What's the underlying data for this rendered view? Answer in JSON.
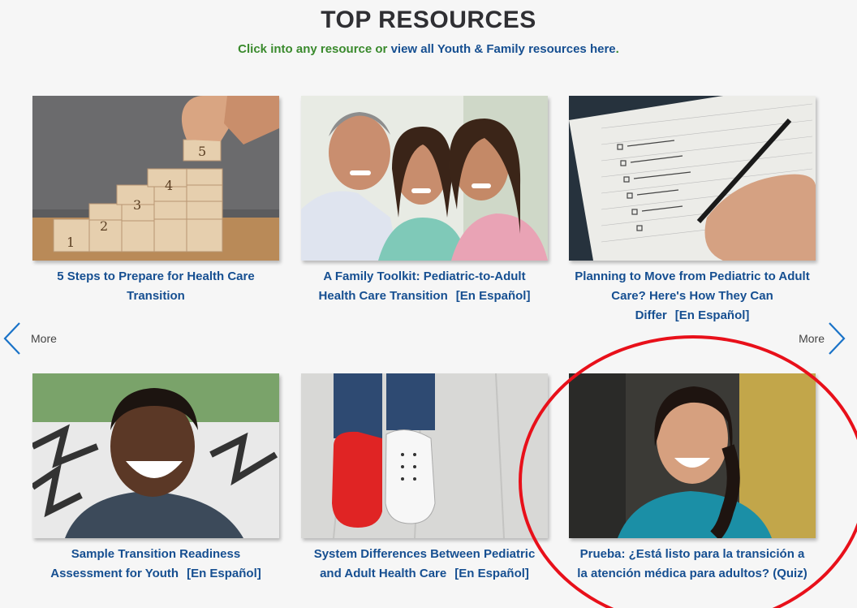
{
  "header": {
    "title": "TOP RESOURCES",
    "sub_prefix": "Click into any resource or ",
    "sub_link": "view all Youth & Family resources here",
    "sub_suffix": "."
  },
  "nav": {
    "prev_label": "More",
    "next_label": "More"
  },
  "cards": [
    {
      "title": "5 Steps to Prepare for Health Care Transition",
      "spanish": ""
    },
    {
      "title": "A Family Toolkit: Pediatric-to-Adult Health Care Transition",
      "spanish": "[En Español]"
    },
    {
      "title": "Planning to Move from Pediatric to Adult Care? Here's How They Can Differ",
      "spanish": "[En Español]"
    },
    {
      "title": "Sample Transition Readiness Assessment for Youth",
      "spanish": "[En Español]"
    },
    {
      "title": "System Differences Between Pediatric and Adult Health Care",
      "spanish": "[En Español]"
    },
    {
      "title": "Prueba: ¿Está listo para la transición a la atención médica para adultos? (Quiz)",
      "spanish": ""
    }
  ],
  "colors": {
    "link_blue": "#164f91",
    "sub_green": "#3a8a2d",
    "chevron_blue": "#1a73c8",
    "annotation_red": "#e8101a"
  },
  "icons": {
    "prev": "chevron-left-icon",
    "next": "chevron-right-icon"
  }
}
